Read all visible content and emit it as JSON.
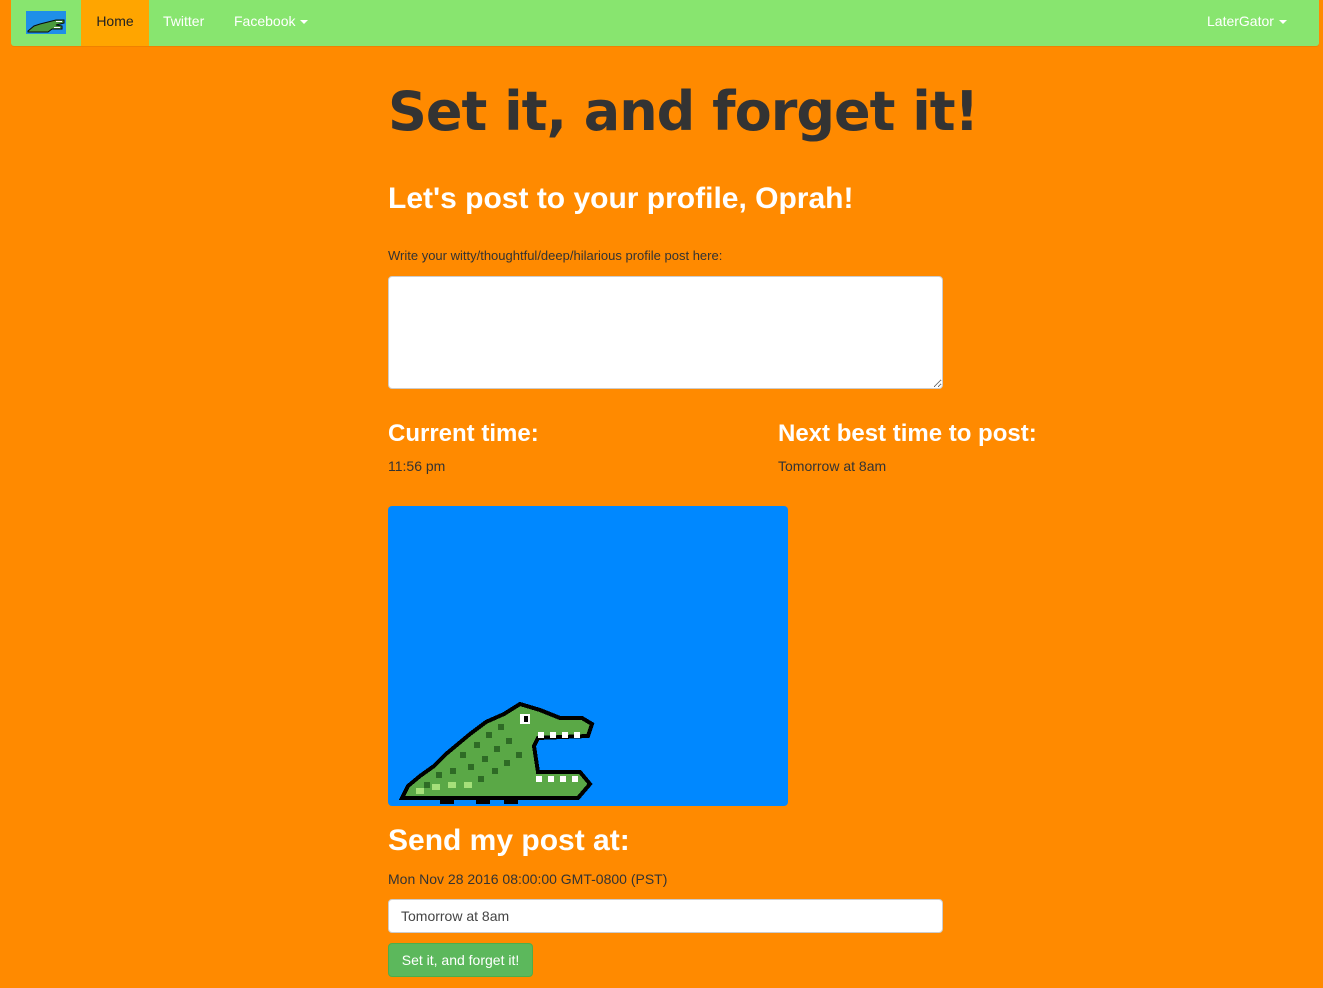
{
  "nav": {
    "brand_icon": "gator-logo-icon",
    "items": [
      {
        "label": "Home",
        "active": true
      },
      {
        "label": "Twitter"
      },
      {
        "label": "Facebook",
        "dropdown": true
      }
    ],
    "user_label": "LaterGator"
  },
  "hero": {
    "title": "Set it, and forget it!"
  },
  "form": {
    "greeting": "Let's post to your profile, Oprah!",
    "post_label": "Write your witty/thoughtful/deep/hilarious profile post here:",
    "post_value": "",
    "current_time_label": "Current time:",
    "current_time": "11:56 pm",
    "next_best_label": "Next best time to post:",
    "next_best_time": "Tomorrow at 8am",
    "image_icon": "pixel-alligator-icon",
    "send_label": "Send my post at:",
    "send_date": "Mon Nov 28 2016 08:00:00 GMT-0800 (PST)",
    "send_input_value": "Tomorrow at 8am",
    "submit_label": "Set it, and forget it!"
  },
  "colors": {
    "page_bg": "#ff8a00",
    "navbar_bg": "#88e56f",
    "active_tab_bg": "#ffa500",
    "image_bg": "#0088ff",
    "button_bg": "#5cb85c"
  }
}
